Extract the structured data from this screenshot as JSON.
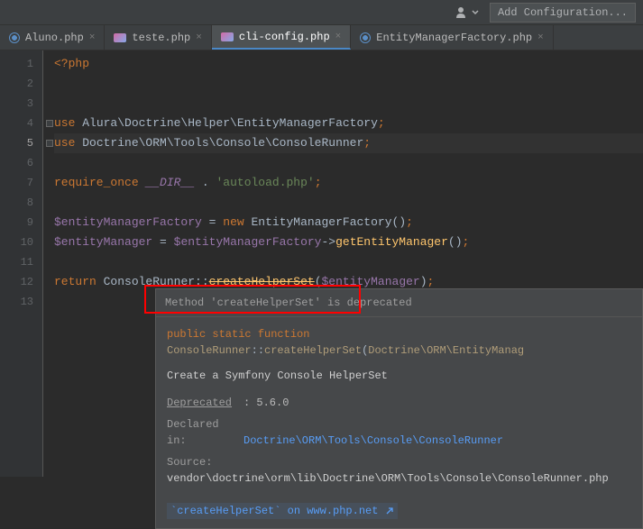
{
  "toolbar": {
    "add_config": "Add Configuration..."
  },
  "tabs": [
    {
      "name": "Aluno.php",
      "active": false,
      "icon": 1
    },
    {
      "name": "teste.php",
      "active": false,
      "icon": 2
    },
    {
      "name": "cli-config.php",
      "active": true,
      "icon": 2
    },
    {
      "name": "EntityManagerFactory.php",
      "active": false,
      "icon": 1
    }
  ],
  "gutter": {
    "start": 1,
    "end": 13,
    "active": 5
  },
  "code": {
    "l1": {
      "open": "<?php"
    },
    "l4": {
      "use": "use",
      "ns": "Alura\\Doctrine\\Helper\\EntityManagerFactory",
      "semi": ";"
    },
    "l5": {
      "use": "use",
      "ns": "Doctrine\\ORM\\Tools\\Console\\ConsoleRunner",
      "semi": ";"
    },
    "l7": {
      "req": "require_once",
      "dir": "__DIR__",
      "dot": ".",
      "str": "'autoload.php'",
      "semi": ";"
    },
    "l9": {
      "var": "$entityManagerFactory",
      "eq": "=",
      "new": "new",
      "cls": "EntityManagerFactory",
      "par": "()",
      "semi": ";"
    },
    "l10": {
      "var": "$entityManager",
      "eq": "=",
      "var2": "$entityManagerFactory",
      "arrow": "->",
      "mtd": "getEntityManager",
      "par": "()",
      "semi": ";"
    },
    "l12": {
      "ret": "return",
      "cls": "ConsoleRunner",
      "scope": "::",
      "mtd": "createHelperSet",
      "open": "(",
      "var": "$entityManager",
      "close": ")",
      "semi": ";"
    }
  },
  "tooltip": {
    "deprecated_msg": "Method 'createHelperSet' is deprecated",
    "sig": {
      "mods": "public static function",
      "cls": "ConsoleRunner",
      "scope": "::",
      "mtd": "createHelperSet",
      "open": "(",
      "param_type": "Doctrine\\ORM\\EntityManag"
    },
    "desc": "Create a Symfony Console HelperSet",
    "deprecated_label": "Deprecated",
    "deprecated_val": ": 5.6.0",
    "declared_label": "Declared in:",
    "declared_val": "Doctrine\\ORM\\Tools\\Console\\ConsoleRunner",
    "source_label": "Source:",
    "source_val": "vendor\\doctrine\\orm\\lib\\Doctrine\\ORM\\Tools\\Console\\ConsoleRunner.php",
    "footer_link": "`createHelperSet` on www.php.net"
  }
}
